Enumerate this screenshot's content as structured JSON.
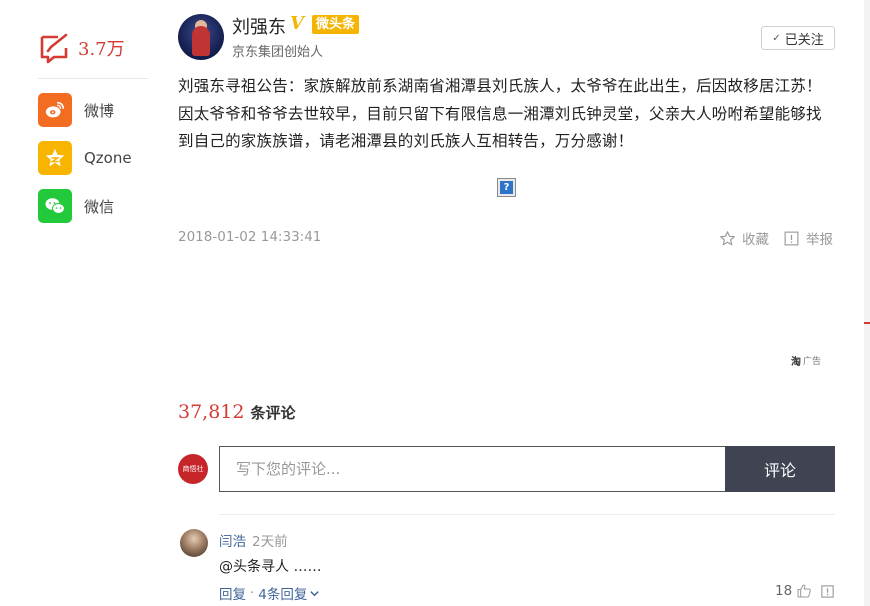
{
  "share_rail": {
    "comment_count": "3.7万",
    "items": [
      {
        "label": "微博",
        "icon": "weibo-icon",
        "color": "#f26d22"
      },
      {
        "label": "Qzone",
        "icon": "qzone-star-icon",
        "color": "#f7b500"
      },
      {
        "label": "微信",
        "icon": "wechat-icon",
        "color": "#22c93b"
      }
    ]
  },
  "author": {
    "name": "刘强东",
    "verified_mark": "V",
    "badge": "微头条",
    "title": "京东集团创始人",
    "follow_label": "已关注"
  },
  "post": {
    "text": "刘强东寻祖公告：家族解放前系湖南省湘潭县刘氏族人，太爷爷在此出生，后因故移居江苏！因太爷爷和爷爷去世较早，目前只留下有限信息一湘潭刘氏钟灵堂，父亲大人吩咐希望能够找到自己的家族族谱，请老湘潭县的刘氏族人互相转告，万分感谢！",
    "image_placeholder": "?",
    "timestamp": "2018-01-02 14:33:41",
    "favorite_label": "收藏",
    "report_label": "举报"
  },
  "ad": {
    "logo_text": "淘",
    "label": "广告"
  },
  "comments": {
    "total": "37,812",
    "total_label": "条评论",
    "my_avatar_text": "商悟社",
    "input_placeholder": "写下您的评论...",
    "submit_label": "评论",
    "list": [
      {
        "user": "闫浩",
        "time": "2天前",
        "text": "@头条寻人 ……",
        "reply_label": "回复",
        "replies_label": "4条回复",
        "likes": "18"
      }
    ]
  },
  "colors": {
    "accent_red": "#d43c33",
    "link_blue": "#406599",
    "button_dark": "#3f4352",
    "verify_gold": "#f5b400"
  }
}
